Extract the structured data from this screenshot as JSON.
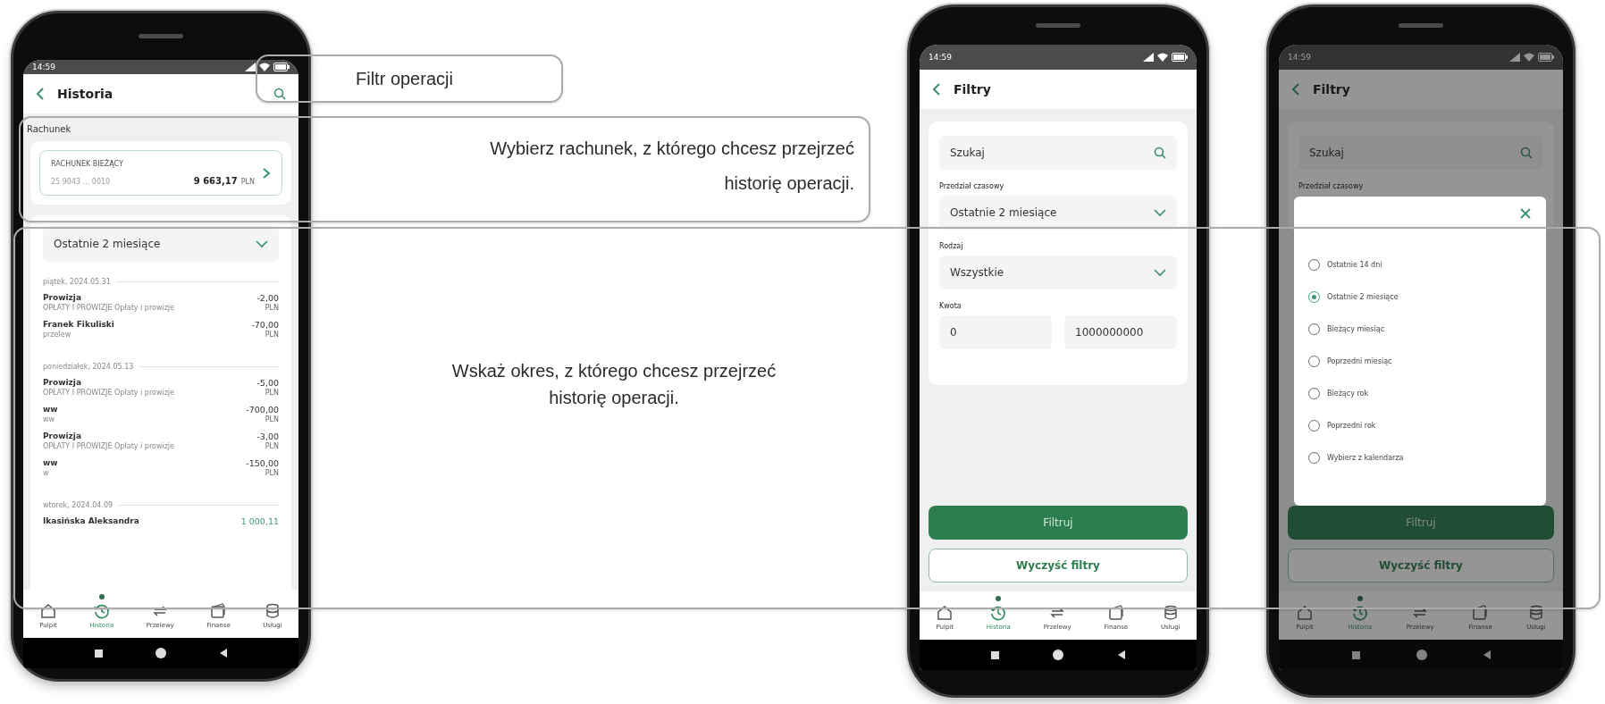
{
  "callouts": [
    {
      "text": "Filtr operacji"
    },
    {
      "text": "Wybierz rachunek, z którego chcesz przejrzeć historię operacji."
    },
    {
      "text": "Wskaż okres, z którego chcesz przejrzeć historię operacji."
    }
  ],
  "phones": [
    {
      "kind": "history",
      "status_bar": {
        "time": "14:59"
      },
      "header": {
        "title": "Historia"
      },
      "account_label": "Rachunek",
      "account": {
        "name": "RACHUNEK BIEŻĄCY",
        "number": "25 9043 ... 0010",
        "balance": "9 663,17",
        "currency": "PLN"
      },
      "period": "Ostatnie 2 miesiące",
      "groups": [
        {
          "date": "piątek, 2024.05.31",
          "transactions": [
            {
              "title": "Prowizja",
              "subtitle": "OPŁATY I PROWIZJE Opłaty i prowizje",
              "amount": "-2,00",
              "currency": "PLN",
              "kind": "debit"
            },
            {
              "title": "Franek Fikuliski",
              "subtitle": "przelew",
              "amount": "-70,00",
              "currency": "PLN",
              "kind": "debit"
            }
          ]
        },
        {
          "date": "poniedziałek, 2024.05.13",
          "transactions": [
            {
              "title": "Prowizja",
              "subtitle": "OPŁATY I PROWIZJE Opłaty i prowizje",
              "amount": "-5,00",
              "currency": "PLN",
              "kind": "debit"
            },
            {
              "title": "ww",
              "subtitle": "ww",
              "amount": "-700,00",
              "currency": "PLN",
              "kind": "debit"
            },
            {
              "title": "Prowizja",
              "subtitle": "OPŁATY I PROWIZJE Opłaty i prowizje",
              "amount": "-3,00",
              "currency": "PLN",
              "kind": "debit"
            },
            {
              "title": "ww",
              "subtitle": "w",
              "amount": "-150,00",
              "currency": "PLN",
              "kind": "debit"
            }
          ]
        },
        {
          "date": "wtorek, 2024.04.09",
          "transactions": [
            {
              "title": "Ikasińska Aleksandra",
              "amount": "1 000,11",
              "kind": "credit"
            }
          ]
        }
      ],
      "bottom_nav": [
        {
          "label": "Pulpit",
          "selected": false
        },
        {
          "label": "Historia",
          "selected": true
        },
        {
          "label": "Przelewy",
          "selected": false
        },
        {
          "label": "Finanse",
          "selected": false
        },
        {
          "label": "Usługi",
          "selected": false
        }
      ]
    },
    {
      "kind": "filters",
      "status_bar": {
        "time": "14:59"
      },
      "header": {
        "title": "Filtry"
      },
      "fields": [
        {
          "kind": "search",
          "placeholder": "Szukaj"
        },
        {
          "kind": "select",
          "label": "Przedział czasowy",
          "value": "Ostatnie 2 miesiące"
        },
        {
          "kind": "select",
          "label": "Rodzaj",
          "value": "Wszystkie"
        },
        {
          "kind": "range",
          "label": "Kwota",
          "from": "0",
          "to": "1000000000"
        }
      ],
      "buttons": [
        {
          "label": "Filtruj",
          "kind": "primary"
        },
        {
          "label": "Wyczyść filtry",
          "kind": "outline"
        }
      ],
      "bottom_nav": [
        {
          "label": "Pulpit",
          "selected": false
        },
        {
          "label": "Historia",
          "selected": true
        },
        {
          "label": "Przelewy",
          "selected": false
        },
        {
          "label": "Finanse",
          "selected": false
        },
        {
          "label": "Usługi",
          "selected": false
        }
      ]
    },
    {
      "kind": "filters",
      "status_bar": {
        "time": "14:59"
      },
      "header": {
        "title": "Filtry"
      },
      "fields": [
        {
          "kind": "search",
          "placeholder": "Szukaj"
        },
        {
          "kind": "label",
          "label": "Przedział czasowy"
        }
      ],
      "buttons": [
        {
          "label": "Filtruj",
          "kind": "primary"
        },
        {
          "label": "Wyczyść filtry",
          "kind": "outline"
        }
      ],
      "bottom_nav": [
        {
          "label": "Pulpit",
          "selected": false
        },
        {
          "label": "Historia",
          "selected": true
        },
        {
          "label": "Przelewy",
          "selected": false
        },
        {
          "label": "Finanse",
          "selected": false
        },
        {
          "label": "Usługi",
          "selected": false
        }
      ],
      "modal": {
        "options": [
          {
            "label": "Ostatnie 14 dni",
            "selected": false
          },
          {
            "label": "Ostatnie 2 miesiące",
            "selected": true
          },
          {
            "label": "Bieżący miesiąc",
            "selected": false
          },
          {
            "label": "Poprzedni miesiąc",
            "selected": false
          },
          {
            "label": "Bieżący rok",
            "selected": false
          },
          {
            "label": "Poprzedni rok",
            "selected": false
          },
          {
            "label": "Wybierz z kalendarza",
            "selected": false
          }
        ]
      }
    }
  ]
}
